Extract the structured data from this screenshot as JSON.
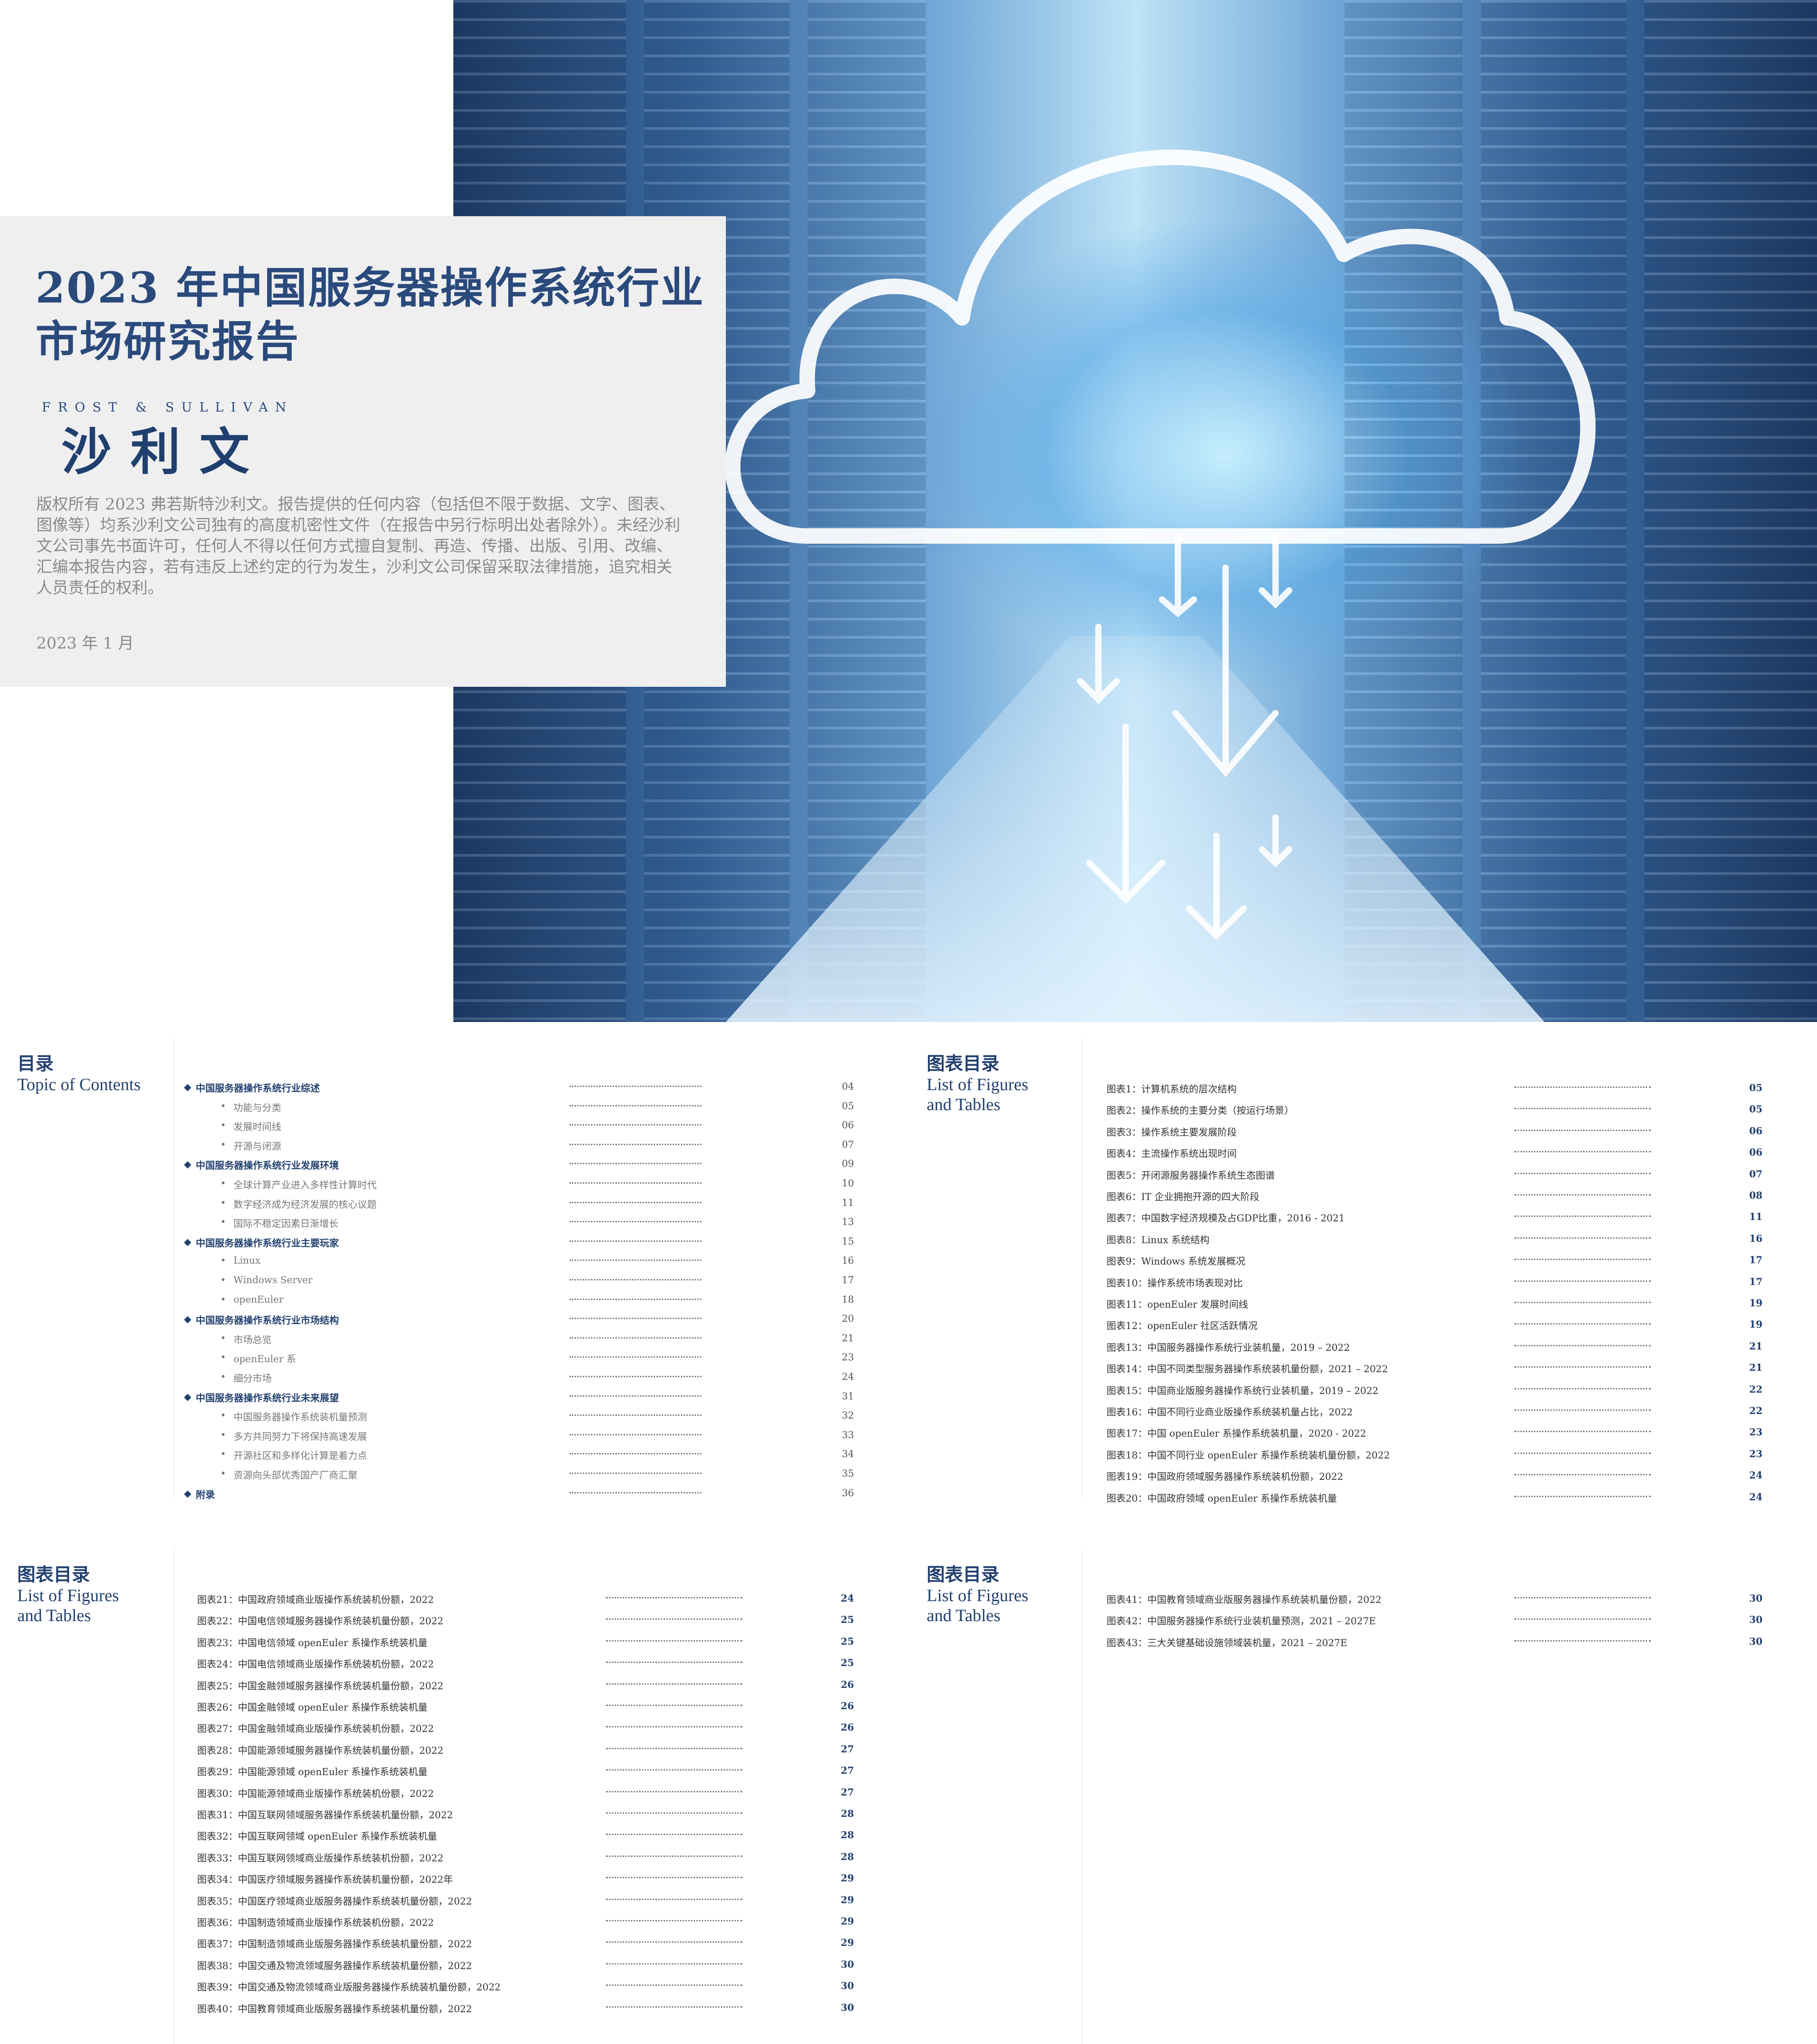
{
  "cover": {
    "title_line1": "2023 年中国服务器操作系统行业",
    "title_line2": "市场研究报告",
    "brand_en": "FROST & SULLIVAN",
    "brand_cn": "沙利文",
    "copyright": "版权所有 2023 弗若斯特沙利文。报告提供的任何内容（包括但不限于数据、文字、图表、图像等）均系沙利文公司独有的高度机密性文件（在报告中另行标明出处者除外）。未经沙利文公司事先书面许可，任何人不得以任何方式擅自复制、再造、传播、出版、引用、改编、汇编本报告内容，若有违反上述约定的行为发生，沙利文公司保留采取法律措施，追究相关人员责任的权利。",
    "date": "2023 年 1 月",
    "hero_image": "cloud-data-center-icon",
    "accent_color": "#2a4a7c"
  },
  "toc": {
    "title_cn": "目录",
    "title_en": "Topic of Contents",
    "items": [
      {
        "level": 1,
        "label": "中国服务器操作系统行业综述",
        "page": "04"
      },
      {
        "level": 2,
        "label": "功能与分类",
        "page": "05"
      },
      {
        "level": 2,
        "label": "发展时间线",
        "page": "06"
      },
      {
        "level": 2,
        "label": "开源与闭源",
        "page": "07"
      },
      {
        "level": 1,
        "label": "中国服务器操作系统行业发展环境",
        "page": "09"
      },
      {
        "level": 2,
        "label": "全球计算产业进入多样性计算时代",
        "page": "10"
      },
      {
        "level": 2,
        "label": "数字经济成为经济发展的核心议题",
        "page": "11"
      },
      {
        "level": 2,
        "label": "国际不稳定因素日渐增长",
        "page": "13"
      },
      {
        "level": 1,
        "label": "中国服务器操作系统行业主要玩家",
        "page": "15"
      },
      {
        "level": 2,
        "label": "Linux",
        "page": "16"
      },
      {
        "level": 2,
        "label": "Windows Server",
        "page": "17"
      },
      {
        "level": 2,
        "label": "openEuler",
        "page": "18"
      },
      {
        "level": 1,
        "label": "中国服务器操作系统行业市场结构",
        "page": "20"
      },
      {
        "level": 2,
        "label": "市场总览",
        "page": "21"
      },
      {
        "level": 2,
        "label": "openEuler 系",
        "page": "23"
      },
      {
        "level": 2,
        "label": "细分市场",
        "page": "24"
      },
      {
        "level": 1,
        "label": "中国服务器操作系统行业未来展望",
        "page": "31"
      },
      {
        "level": 2,
        "label": "中国服务器操作系统装机量预测",
        "page": "32"
      },
      {
        "level": 2,
        "label": "多方共同努力下将保持高速发展",
        "page": "33"
      },
      {
        "level": 2,
        "label": "开源社区和多样化计算是着力点",
        "page": "34"
      },
      {
        "level": 2,
        "label": "资源向头部优秀国产厂商汇聚",
        "page": "35"
      },
      {
        "level": 1,
        "label": "附录",
        "page": "36"
      }
    ]
  },
  "figures_heading": {
    "title_cn": "图表目录",
    "title_en_line1": "List of Figures",
    "title_en_line2": "and Tables"
  },
  "figures": [
    [
      {
        "label": "图表1：计算机系统的层次结构",
        "page": "05"
      },
      {
        "label": "图表2：操作系统的主要分类（按运行场景）",
        "page": "05"
      },
      {
        "label": "图表3：操作系统主要发展阶段",
        "page": "06"
      },
      {
        "label": "图表4：主流操作系统出现时间",
        "page": "06"
      },
      {
        "label": "图表5：开闭源服务器操作系统生态图谱",
        "page": "07"
      },
      {
        "label": "图表6：IT 企业拥抱开源的四大阶段",
        "page": "08"
      },
      {
        "label": "图表7：中国数字经济规模及占GDP比重，2016 - 2021",
        "page": "11"
      },
      {
        "label": "图表8：Linux 系统结构",
        "page": "16"
      },
      {
        "label": "图表9：Windows 系统发展概况",
        "page": "17"
      },
      {
        "label": "图表10：操作系统市场表现对比",
        "page": "17"
      },
      {
        "label": "图表11：openEuler 发展时间线",
        "page": "19"
      },
      {
        "label": "图表12：openEuler 社区活跃情况",
        "page": "19"
      },
      {
        "label": "图表13：中国服务器操作系统行业装机量，2019 – 2022",
        "page": "21"
      },
      {
        "label": "图表14：中国不同类型服务器操作系统装机量份额，2021 – 2022",
        "page": "21"
      },
      {
        "label": "图表15：中国商业版服务器操作系统行业装机量，2019 – 2022",
        "page": "22"
      },
      {
        "label": "图表16：中国不同行业商业版操作系统装机量占比，2022",
        "page": "22"
      },
      {
        "label": "图表17：中国 openEuler 系操作系统装机量，2020 - 2022",
        "page": "23"
      },
      {
        "label": "图表18：中国不同行业 openEuler 系操作系统装机量份额，2022",
        "page": "23"
      },
      {
        "label": "图表19：中国政府领域服务器操作系统装机份额，2022",
        "page": "24"
      },
      {
        "label": "图表20：中国政府领域 openEuler 系操作系统装机量",
        "page": "24"
      }
    ],
    [
      {
        "label": "图表21：中国政府领域商业版操作系统装机份额，2022",
        "page": "24"
      },
      {
        "label": "图表22：中国电信领域服务器操作系统装机量份额，2022",
        "page": "25"
      },
      {
        "label": "图表23：中国电信领域 openEuler 系操作系统装机量",
        "page": "25"
      },
      {
        "label": "图表24：中国电信领域商业版操作系统装机份额，2022",
        "page": "25"
      },
      {
        "label": "图表25：中国金融领域服务器操作系统装机量份额，2022",
        "page": "26"
      },
      {
        "label": "图表26：中国金融领域 openEuler 系操作系统装机量",
        "page": "26"
      },
      {
        "label": "图表27：中国金融领域商业版操作系统装机份额，2022",
        "page": "26"
      },
      {
        "label": "图表28：中国能源领域服务器操作系统装机量份额，2022",
        "page": "27"
      },
      {
        "label": "图表29：中国能源领域 openEuler 系操作系统装机量",
        "page": "27"
      },
      {
        "label": "图表30：中国能源领域商业版操作系统装机份额，2022",
        "page": "27"
      },
      {
        "label": "图表31：中国互联网领域服务器操作系统装机量份额，2022",
        "page": "28"
      },
      {
        "label": "图表32：中国互联网领域 openEuler 系操作系统装机量",
        "page": "28"
      },
      {
        "label": "图表33：中国互联网领域商业版操作系统装机份额，2022",
        "page": "28"
      },
      {
        "label": "图表34：中国医疗领域服务器操作系统装机量份额，2022年",
        "page": "29"
      },
      {
        "label": "图表35：中国医疗领域商业版服务器操作系统装机量份额，2022",
        "page": "29"
      },
      {
        "label": "图表36：中国制造领域商业版操作系统装机份额，2022",
        "page": "29"
      },
      {
        "label": "图表37：中国制造领域商业版服务器操作系统装机量份额，2022",
        "page": "29"
      },
      {
        "label": "图表38：中国交通及物流领域服务器操作系统装机量份额，2022",
        "page": "30"
      },
      {
        "label": "图表39：中国交通及物流领域商业版服务器操作系统装机量份额，2022",
        "page": "30"
      },
      {
        "label": "图表40：中国教育领域商业版服务器操作系统装机量份额，2022",
        "page": "30"
      }
    ],
    [
      {
        "label": "图表41：中国教育领域商业版服务器操作系统装机量份额，2022",
        "page": "30"
      },
      {
        "label": "图表42：中国服务器操作系统行业装机量预测，2021 – 2027E",
        "page": "30"
      },
      {
        "label": "图表43：三大关键基础设施领域装机量，2021 – 2027E",
        "page": "30"
      }
    ]
  ]
}
